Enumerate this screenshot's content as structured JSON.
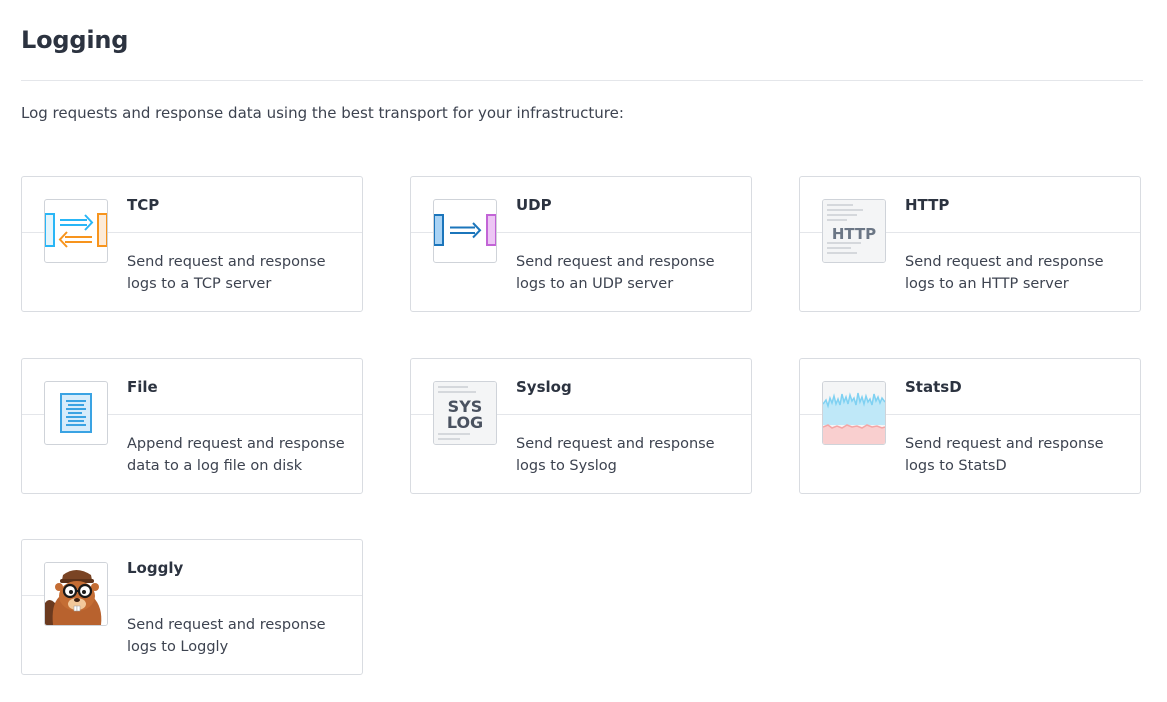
{
  "page": {
    "title": "Logging",
    "intro": "Log requests and response data using the best transport for your infrastructure:"
  },
  "colors": {
    "card_border": "#d9dce1",
    "divider": "#e4e6ea",
    "tcp_blue": "#29b6f6",
    "tcp_orange": "#f7941d",
    "udp_blue": "#1b75bb",
    "udp_purple": "#c264d6",
    "file_blue": "#3aa3e3",
    "statsd_blue": "#7fd1f2",
    "statsd_red": "#f4a6a6"
  },
  "endpoints": [
    {
      "id": "tcp",
      "name": "TCP",
      "icon": "tcp-transfer-icon",
      "desc_line1": "Send request and response",
      "desc_line2": "logs to a TCP server"
    },
    {
      "id": "udp",
      "name": "UDP",
      "icon": "udp-transfer-icon",
      "desc_line1": "Send request and response",
      "desc_line2": "logs to an UDP server"
    },
    {
      "id": "http",
      "name": "HTTP",
      "icon": "http-document-icon",
      "icon_text": "HTTP",
      "desc_line1": "Send request and response",
      "desc_line2": "logs to an HTTP server"
    },
    {
      "id": "file",
      "name": "File",
      "icon": "file-document-icon",
      "desc_line1": "Append request and response",
      "desc_line2": "data to a log file on disk"
    },
    {
      "id": "syslog",
      "name": "Syslog",
      "icon": "syslog-icon",
      "icon_text_1": "SYS",
      "icon_text_2": "LOG",
      "desc_line1": "Send request and response",
      "desc_line2": "logs to Syslog"
    },
    {
      "id": "statsd",
      "name": "StatsD",
      "icon": "statsd-graph-icon",
      "desc_line1": "Send request and response",
      "desc_line2": "logs to StatsD"
    },
    {
      "id": "loggly",
      "name": "Loggly",
      "icon": "loggly-beaver-icon",
      "desc_line1": "Send request and response",
      "desc_line2": "logs to Loggly"
    }
  ]
}
